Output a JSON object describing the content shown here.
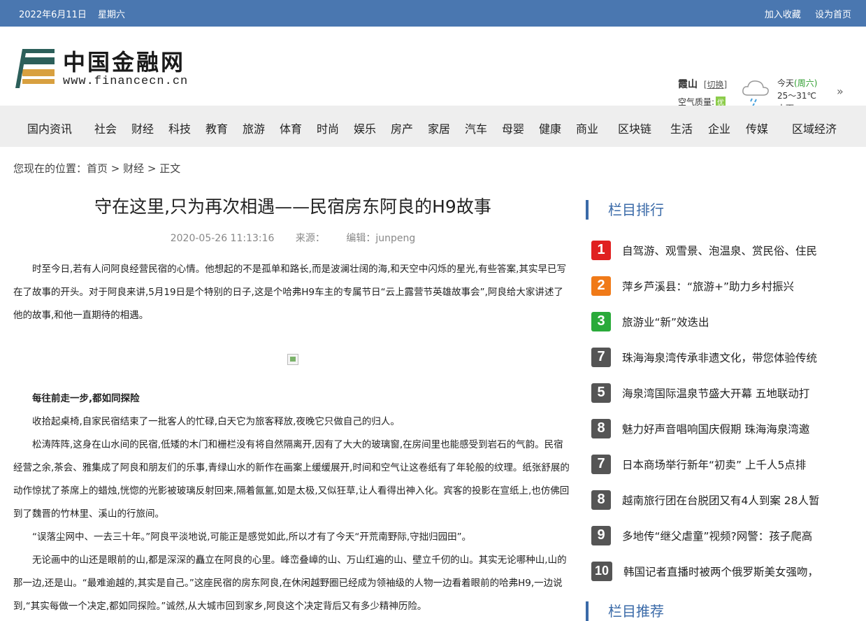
{
  "topbar": {
    "date": "2022年6月11日",
    "weekday": "星期六",
    "bookmark": "加入收藏",
    "homepage": "设为首页"
  },
  "logo": {
    "cn": "中国金融网",
    "en": "www.financecn.cn"
  },
  "weather": {
    "city": "霞山",
    "switch": "[切换]",
    "aq_label": "空气质量:",
    "aq_value": "优",
    "today": "今天",
    "weekday": "(周六)",
    "temp": "25～31℃",
    "condition": "中雨",
    "icon": "rain-cloud-icon"
  },
  "nav": {
    "items": [
      "国内资讯",
      "社会",
      "财经",
      "科技",
      "教育",
      "旅游",
      "体育",
      "时尚",
      "娱乐",
      "房产",
      "家居",
      "汽车",
      "母婴",
      "健康",
      "商业",
      "区块链",
      "生活",
      "企业",
      "传媒",
      "区域经济"
    ]
  },
  "breadcrumb": {
    "prefix": "您现在的位置：",
    "home": "首页",
    "sep": " > ",
    "category": "财经",
    "current": "正文"
  },
  "article": {
    "title": "守在这里,只为再次相遇——民宿房东阿良的H9故事",
    "datetime": "2020-05-26 11:13:16",
    "source": "来源：",
    "editor": "编辑：junpeng",
    "p1": "时至今日,若有人问阿良经营民宿的心情。他想起的不是孤单和路长,而是波澜壮阔的海,和天空中闪烁的星光,有些答案,其实早已写在了故事的开头。对于阿良来讲,5月19日是个特别的日子,这是个哈弗H9车主的专属节日“云上露营节英雄故事会”,阿良给大家讲述了他的故事,和他一直期待的相遇。",
    "subheading": "每往前走一步,都如同探险",
    "p2": "收拾起桌椅,自家民宿结束了一批客人的忙碌,白天它为旅客释放,夜晚它只做自己的归人。",
    "p3": "松涛阵阵,这身在山水间的民宿,低矮的木门和栅栏没有将自然隔离开,因有了大大的玻璃窗,在房间里也能感受到岩石的气韵。民宿经营之余,茶会、雅集成了阿良和朋友们的乐事,青绿山水的新作在画案上缓缓展开,时间和空气让这卷纸有了年轮般的纹理。纸张舒展的动作惊扰了茶席上的蜡烛,恍惚的光影被玻璃反射回来,隔着氤氲,如是太极,又似狂草,让人看得出神入化。宾客的投影在宣纸上,也仿佛回到了魏晋的竹林里、溪山的行旅间。",
    "p4": "“误落尘网中、一去三十年。”阿良平淡地说,可能正是感觉如此,所以才有了今天“开荒南野际,守拙归园田”。",
    "p5": "无论画中的山还是眼前的山,都是深深的矗立在阿良的心里。峰峦叠嶂的山、万山红遍的山、壁立千仞的山。其实无论哪种山,山的那一边,还是山。“最难逾越的,其实是自己。”这座民宿的房东阿良,在休闲越野圈已经成为领袖级的人物一边看着眼前的哈弗H9,一边说到,“其实每做一个决定,都如同探险。”诚然,从大城市回到家乡,阿良这个决定背后又有多少精神历险。"
  },
  "sidebar": {
    "rank_title": "栏目排行",
    "recommend_title": "栏目推荐",
    "items": [
      {
        "rank": "1",
        "text": "自驾游、观雪景、泡温泉、赏民俗、住民"
      },
      {
        "rank": "2",
        "text": "萍乡芦溪县：“旅游+”助力乡村振兴"
      },
      {
        "rank": "3",
        "text": "旅游业“新”效迭出"
      },
      {
        "rank": "7",
        "text": "珠海海泉湾传承非遗文化，带您体验传统"
      },
      {
        "rank": "5",
        "text": "海泉湾国际温泉节盛大开幕 五地联动打"
      },
      {
        "rank": "8",
        "text": "魅力好声音唱响国庆假期 珠海海泉湾邀"
      },
      {
        "rank": "7",
        "text": "日本商场举行新年“初卖” 上千人5点排"
      },
      {
        "rank": "8",
        "text": "越南旅行团在台脱团又有4人到案 28人暂"
      },
      {
        "rank": "9",
        "text": "多地传“继父虐童”视频?网警：孩子爬高"
      },
      {
        "rank": "10",
        "text": "韩国记者直播时被两个俄罗斯美女强吻，"
      }
    ]
  }
}
